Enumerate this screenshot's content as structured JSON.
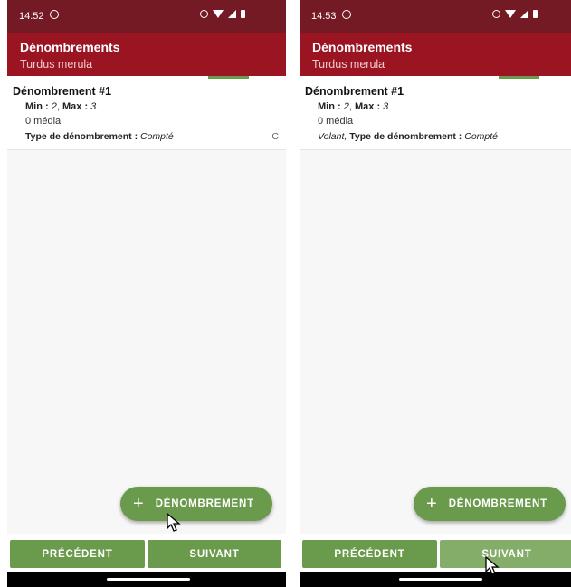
{
  "screens": [
    {
      "status_time": "14:52",
      "title": "Dénombrements",
      "subtitle": "Turdus merula",
      "item": {
        "title": "Dénombrement #1",
        "min_label": "Min :",
        "min_value": "2",
        "max_label": "Max :",
        "max_value": "3",
        "media": "0 média",
        "type_prefix": "",
        "type_label": "Type de dénombrement :",
        "type_value": "Compté",
        "cut_text": "C"
      },
      "fab_label": "DÉNOMBREMENT",
      "prev_label": "PRÉCÉDENT",
      "next_label": "SUIVANT"
    },
    {
      "status_time": "14:53",
      "title": "Dénombrements",
      "subtitle": "Turdus merula",
      "item": {
        "title": "Dénombrement #1",
        "min_label": "Min :",
        "min_value": "2",
        "max_label": "Max :",
        "max_value": "3",
        "media": "0 média",
        "type_prefix": "Volant,",
        "type_label": "Type de dénombrement :",
        "type_value": "Compté",
        "cut_text": ""
      },
      "fab_label": "DÉNOMBREMENT",
      "prev_label": "PRÉCÉDENT",
      "next_label": "SUIVANT"
    }
  ],
  "icons": {
    "status": [
      "whatsapp-icon",
      "alarm-icon",
      "wifi-icon",
      "signal-icon",
      "battery-icon"
    ],
    "fab": "plus-icon",
    "pointer": "cursor-icon"
  },
  "colors": {
    "status_bar": "#741a25",
    "app_bar": "#9a1521",
    "accent_green": "#6a9a4c",
    "background": "#f7f7f7"
  }
}
